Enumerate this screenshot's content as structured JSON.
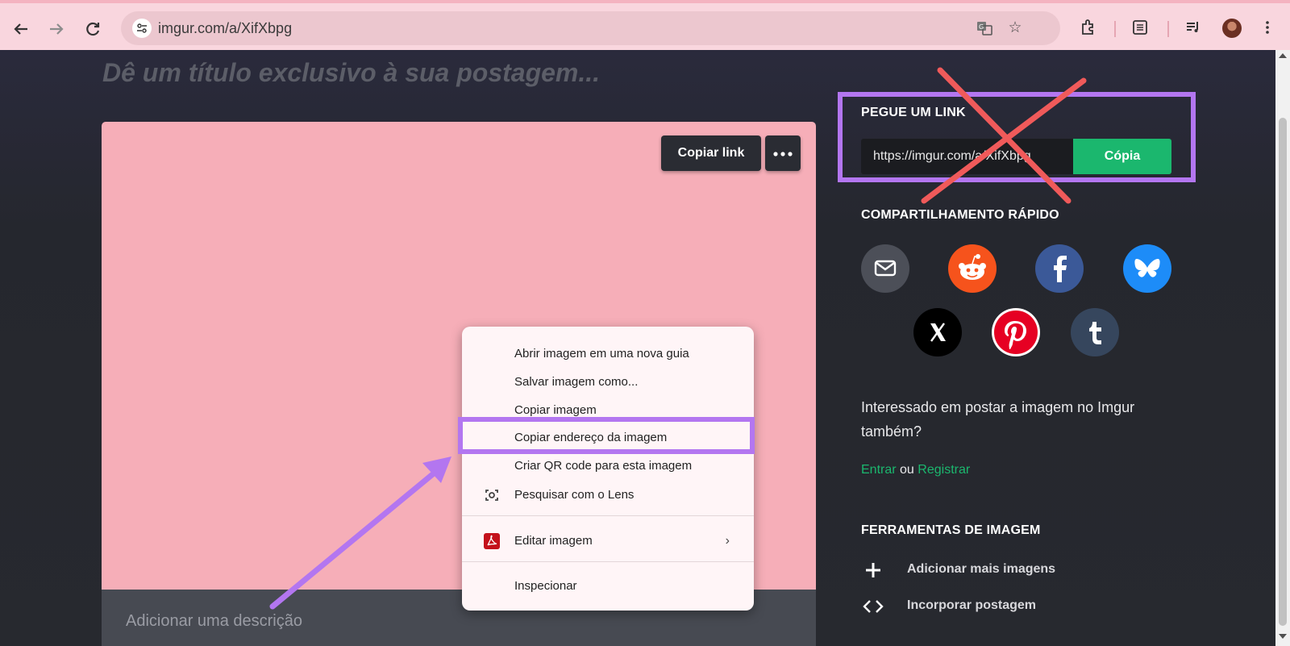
{
  "browser": {
    "url": "imgur.com/a/XifXbpg"
  },
  "page": {
    "title_placeholder": "Dê um título exclusivo à sua postagem...",
    "image_card": {
      "copy_link_label": "Copiar link",
      "more_label": "•••",
      "image_color": "#f6aeb8",
      "description_placeholder": "Adicionar uma descrição"
    },
    "context_menu": {
      "items": [
        "Abrir imagem em uma nova guia",
        "Salvar imagem como...",
        "Copiar imagem",
        "Copiar endereço da imagem",
        "Criar QR code para esta imagem",
        "Pesquisar com o Lens",
        "Editar imagem",
        "Inspecionar"
      ],
      "highlighted_item": "Copiar endereço da imagem"
    },
    "sidebar": {
      "get_link_heading": "PEGUE UM LINK",
      "link_value": "https://imgur.com/a/XifXbpg",
      "copy_button": "Cópia",
      "quick_share_heading": "COMPARTILHAMENTO RÁPIDO",
      "share_icons": [
        "email-icon",
        "reddit-icon",
        "facebook-icon",
        "bluesky-icon",
        "x-icon",
        "pinterest-icon",
        "tumblr-icon"
      ],
      "promo_text": "Interessado em postar a imagem no Imgur também?",
      "login_link": "Entrar",
      "or_text": "ou",
      "register_link": "Registrar",
      "tools_heading": "FERRAMENTAS DE IMAGEM",
      "tools": [
        {
          "icon": "plus-icon",
          "label": "Adicionar mais imagens"
        },
        {
          "icon": "code-icon",
          "label": "Incorporar postagem"
        }
      ]
    }
  },
  "colors": {
    "accent_green": "#1bb76e",
    "annotation_purple": "#b376f0",
    "annotation_red": "#f05a5a"
  }
}
